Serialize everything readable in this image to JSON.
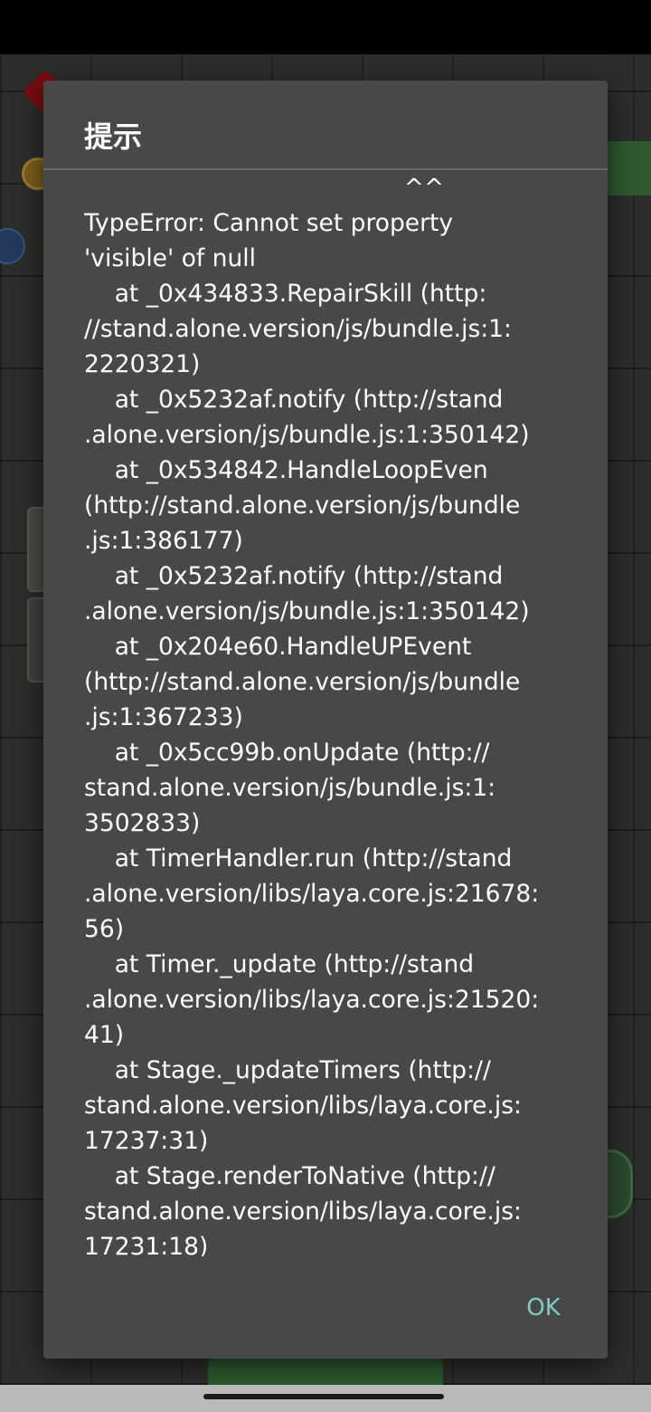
{
  "dialog": {
    "title": "提示",
    "message": "                                          ^^\nTypeError: Cannot set property\n'visible' of null\n    at _0x434833.RepairSkill (http:\n//stand.alone.version/js/bundle.js:1:\n2220321)\n    at _0x5232af.notify (http://stand\n.alone.version/js/bundle.js:1:350142)\n    at _0x534842.HandleLoopEven\n(http://stand.alone.version/js/bundle\n.js:1:386177)\n    at _0x5232af.notify (http://stand\n.alone.version/js/bundle.js:1:350142)\n    at _0x204e60.HandleUPEvent\n(http://stand.alone.version/js/bundle\n.js:1:367233)\n    at _0x5cc99b.onUpdate (http://\nstand.alone.version/js/bundle.js:1:\n3502833)\n    at TimerHandler.run (http://stand\n.alone.version/libs/laya.core.js:21678:\n56)\n    at Timer._update (http://stand\n.alone.version/libs/laya.core.js:21520:\n41)\n    at Stage._updateTimers (http://\nstand.alone.version/libs/laya.core.js:\n17237:31)\n    at Stage.renderToNative (http://\nstand.alone.version/libs/laya.core.js:\n17231:18)",
    "ok_label": "OK"
  },
  "colors": {
    "dialog_background": "#484848",
    "accent": "#80cbc4",
    "text": "#ffffff"
  }
}
